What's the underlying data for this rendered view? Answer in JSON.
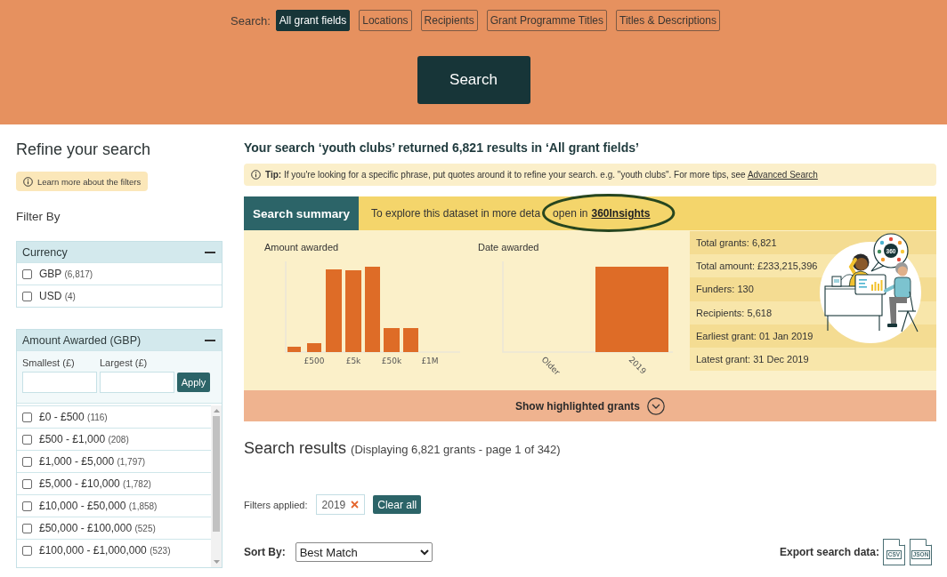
{
  "search_bar": {
    "label": "Search:",
    "tabs": [
      {
        "label": "All grant fields",
        "selected": true
      },
      {
        "label": "Locations",
        "selected": false
      },
      {
        "label": "Recipients",
        "selected": false
      },
      {
        "label": "Grant Programme Titles",
        "selected": false
      },
      {
        "label": "Titles & Descriptions",
        "selected": false
      }
    ],
    "button": "Search"
  },
  "sidebar": {
    "title": "Refine your search",
    "help": "Learn more about the filters",
    "filter_by": "Filter By",
    "panels": [
      {
        "kind": "list",
        "title": "Currency",
        "expanded": true,
        "options": [
          {
            "label": "GBP",
            "count": "(6,817)",
            "checked": false
          },
          {
            "label": "USD",
            "count": "(4)",
            "checked": false
          }
        ]
      },
      {
        "kind": "range",
        "title": "Amount Awarded (GBP)",
        "expanded": true,
        "min_label": "Smallest (£)",
        "max_label": "Largest (£)",
        "apply": "Apply",
        "options": [
          {
            "label": "£0 - £500",
            "count": "(116)",
            "checked": false
          },
          {
            "label": "£500 - £1,000",
            "count": "(208)",
            "checked": false
          },
          {
            "label": "£1,000 - £5,000",
            "count": "(1,797)",
            "checked": false
          },
          {
            "label": "£5,000 - £10,000",
            "count": "(1,782)",
            "checked": false
          },
          {
            "label": "£10,000 - £50,000",
            "count": "(1,858)",
            "checked": false
          },
          {
            "label": "£50,000 - £100,000",
            "count": "(525)",
            "checked": false
          },
          {
            "label": "£100,000 - £1,000,000",
            "count": "(523)",
            "checked": false
          }
        ]
      }
    ]
  },
  "main": {
    "heading": "Your search ‘youth clubs’ returned 6,821 results in ‘All grant fields’",
    "tip": {
      "text": "**Tip:** If you're looking for a specific phrase, put quotes around it to refine your search. e.g. \"youth clubs\". For more tips, see",
      "link": "Advanced Search"
    },
    "summary": {
      "title": "Search summary",
      "explore_text": "To explore this dataset in more deta",
      "open_text": "open in",
      "link": "360Insights",
      "link_circled": true,
      "charts": [
        {
          "kind": "histogram",
          "title": "Amount awarded",
          "labels": [
            "£500",
            "£5k",
            "£50k",
            "£1M"
          ]
        },
        {
          "kind": "columns",
          "title": "Date awarded",
          "labels": [
            "Older",
            "2019"
          ]
        }
      ],
      "stats": [
        "Total grants: 6,821",
        "Total amount: £233,215,396",
        "Funders: 130",
        "Recipients: 5,618",
        "Earliest grant: 01 Jan 2019",
        "Latest grant: 31 Dec 2019"
      ],
      "logo": "360"
    },
    "highlight": {
      "label": "Show highlighted grants",
      "expanded": false
    },
    "results": {
      "title": "Search results",
      "subtitle": "(Displaying 6,821 grants - page 1 of 342)",
      "filters_label": "Filters applied:",
      "filters": [
        "2019"
      ],
      "clear": "Clear all",
      "sort_label": "Sort By:",
      "sort_value": "Best Match",
      "export_label": "Export search data:",
      "exports": [
        "CSV",
        "JSON"
      ]
    }
  }
}
